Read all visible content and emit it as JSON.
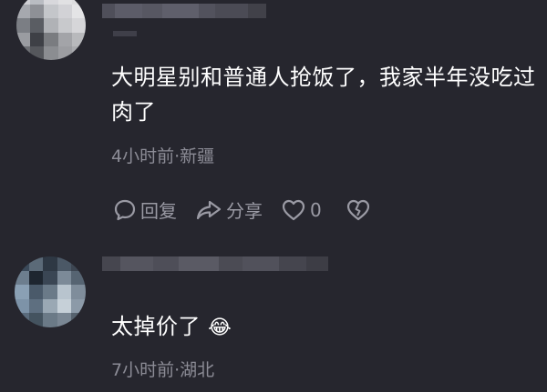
{
  "comments": [
    {
      "text": "大明星别和普通人抢饭了，我家半年没吃过肉了",
      "meta": "4小时前·新疆",
      "actions": {
        "reply_label": "回复",
        "share_label": "分享",
        "like_count": "0"
      }
    },
    {
      "text": "太掉价了",
      "emoji": "😂",
      "meta": "7小时前·湖北"
    }
  ],
  "colors": {
    "background": "#26262e",
    "primary_text": "#ffffff",
    "secondary_text": "#8c8c96",
    "action_icon": "#9a9aa4"
  },
  "icons": {
    "reply": "comment-bubble-icon",
    "share": "share-arrow-icon",
    "like": "heart-outline-icon",
    "dislike": "broken-heart-icon"
  }
}
